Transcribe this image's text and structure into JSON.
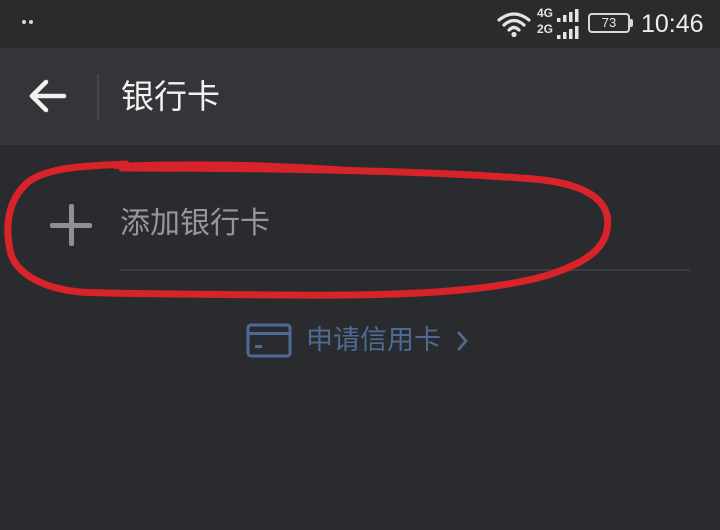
{
  "status_bar": {
    "network_top": "4G",
    "network_bottom": "2G",
    "battery": "73",
    "time": "10:46",
    "icons": [
      "notification-dots-icon",
      "wifi-icon",
      "signal-icon",
      "battery-icon"
    ]
  },
  "header": {
    "back_icon": "arrow-left-icon",
    "title": "银行卡"
  },
  "main": {
    "add_card": {
      "icon": "plus-icon",
      "label": "添加银行卡",
      "annotation_color": "#d8232a"
    },
    "apply_credit": {
      "icon": "card-icon",
      "label": "申请信用卡",
      "chevron": "chevron-right-icon",
      "color": "#4f6b94"
    }
  },
  "colors": {
    "background": "#2a2b2e",
    "title_bar": "#343538",
    "title_text": "#f1f1f1",
    "muted_text": "#96979a",
    "link": "#4f6b94",
    "annotation": "#d8232a"
  }
}
